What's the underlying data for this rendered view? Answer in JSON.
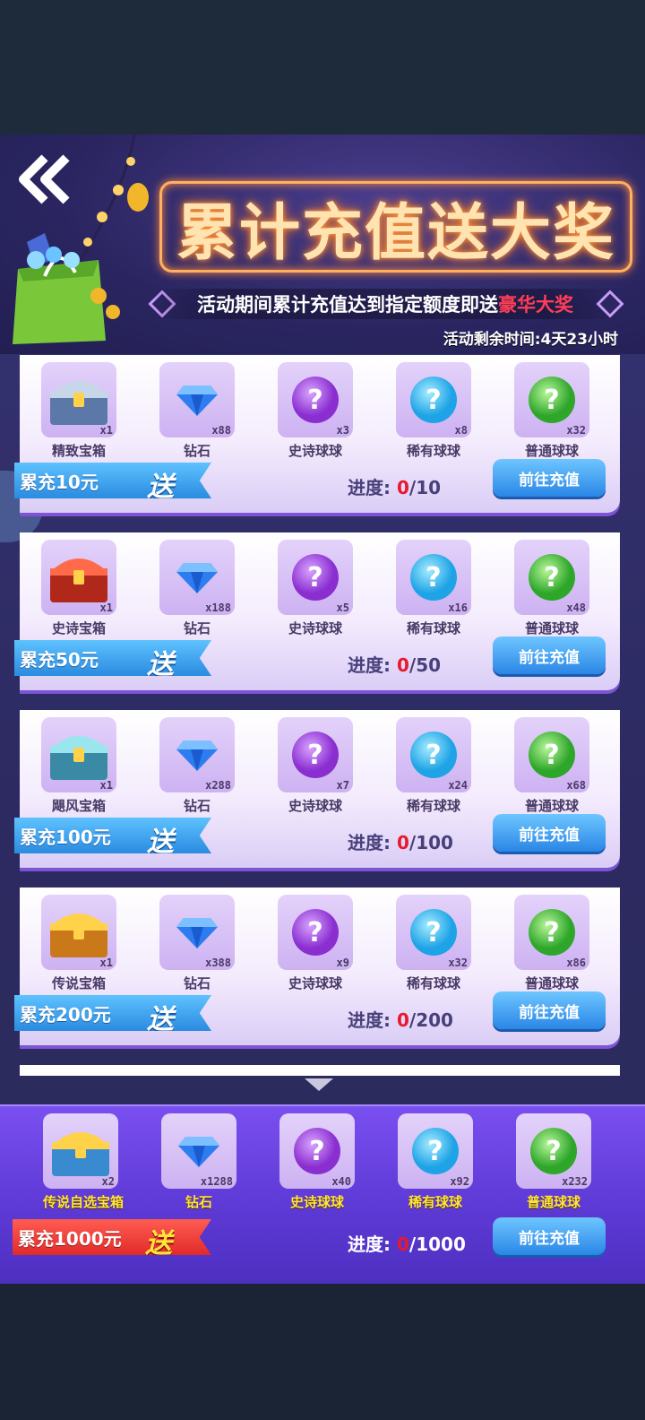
{
  "header": {
    "title": "累计充值送大奖",
    "subtitle_prefix": "活动期间累计充值达到指定额度即送",
    "subtitle_highlight": "豪华大奖",
    "countdown": "活动剩余时间:4天23小时"
  },
  "go_label": "前往充值",
  "progress_label": "进度:",
  "tiers": [
    {
      "ribbon": "累充10元",
      "send": "送",
      "current": "0",
      "target": "/10",
      "rewards": [
        {
          "name": "精致宝箱",
          "qty": "x1",
          "icon": "silver-chest-icon"
        },
        {
          "name": "钻石",
          "qty": "x88",
          "icon": "diamond-icon"
        },
        {
          "name": "史诗球球",
          "qty": "x3",
          "icon": "purple-ball-icon"
        },
        {
          "name": "稀有球球",
          "qty": "x8",
          "icon": "blue-ball-icon"
        },
        {
          "name": "普通球球",
          "qty": "x32",
          "icon": "green-ball-icon"
        }
      ]
    },
    {
      "ribbon": "累充50元",
      "send": "送",
      "current": "0",
      "target": "/50",
      "rewards": [
        {
          "name": "史诗宝箱",
          "qty": "x1",
          "icon": "red-chest-icon"
        },
        {
          "name": "钻石",
          "qty": "x188",
          "icon": "diamond-icon"
        },
        {
          "name": "史诗球球",
          "qty": "x5",
          "icon": "purple-ball-icon"
        },
        {
          "name": "稀有球球",
          "qty": "x16",
          "icon": "blue-ball-icon"
        },
        {
          "name": "普通球球",
          "qty": "x48",
          "icon": "green-ball-icon"
        }
      ]
    },
    {
      "ribbon": "累充100元",
      "send": "送",
      "current": "0",
      "target": "/100",
      "rewards": [
        {
          "name": "飓风宝箱",
          "qty": "x1",
          "icon": "teal-chest-icon"
        },
        {
          "name": "钻石",
          "qty": "x288",
          "icon": "diamond-icon"
        },
        {
          "name": "史诗球球",
          "qty": "x7",
          "icon": "purple-ball-icon"
        },
        {
          "name": "稀有球球",
          "qty": "x24",
          "icon": "blue-ball-icon"
        },
        {
          "name": "普通球球",
          "qty": "x68",
          "icon": "green-ball-icon"
        }
      ]
    },
    {
      "ribbon": "累充200元",
      "send": "送",
      "current": "0",
      "target": "/200",
      "rewards": [
        {
          "name": "传说宝箱",
          "qty": "x1",
          "icon": "gold-chest-icon"
        },
        {
          "name": "钻石",
          "qty": "x388",
          "icon": "diamond-icon"
        },
        {
          "name": "史诗球球",
          "qty": "x9",
          "icon": "purple-ball-icon"
        },
        {
          "name": "稀有球球",
          "qty": "x32",
          "icon": "blue-ball-icon"
        },
        {
          "name": "普通球球",
          "qty": "x86",
          "icon": "green-ball-icon"
        }
      ]
    }
  ],
  "final_tier": {
    "ribbon": "累充1000元",
    "send": "送",
    "current": "0",
    "target": "/1000",
    "rewards": [
      {
        "name": "传说自选宝箱",
        "qty": "x2",
        "icon": "legendary-select-chest-icon"
      },
      {
        "name": "钻石",
        "qty": "x1288",
        "icon": "diamond-icon"
      },
      {
        "name": "史诗球球",
        "qty": "x40",
        "icon": "purple-ball-icon"
      },
      {
        "name": "稀有球球",
        "qty": "x92",
        "icon": "blue-ball-icon"
      },
      {
        "name": "普通球球",
        "qty": "x232",
        "icon": "green-ball-icon"
      }
    ]
  },
  "colors": {
    "accent_blue": "#2a86e6",
    "highlight_red": "#ff3d57",
    "final_purple": "#5e3ad6",
    "neon_orange": "#ffb060"
  }
}
